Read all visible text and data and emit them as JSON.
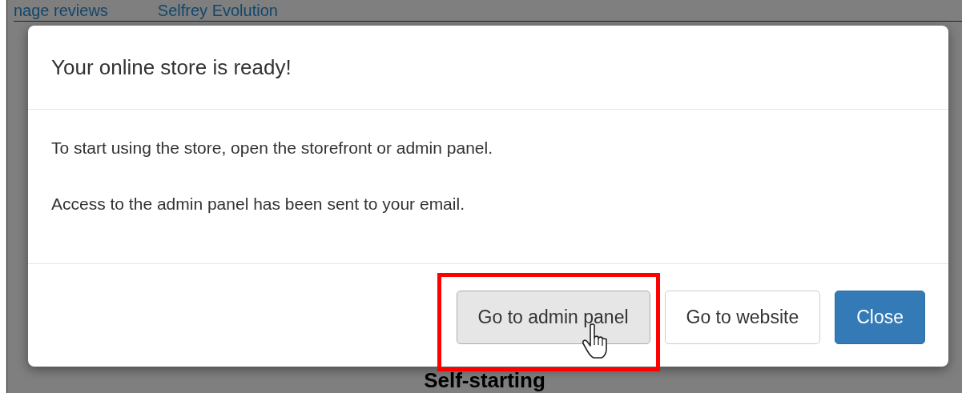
{
  "background": {
    "nav_links": [
      "nage reviews",
      "Selfrey Evolution"
    ],
    "heading": "Self-starting"
  },
  "dialog": {
    "title": "Your online store is ready!",
    "paragraphs": [
      "To start using the store, open the storefront or admin panel.",
      "Access to the admin panel has been sent to your email."
    ],
    "buttons": [
      {
        "label": "Go to admin panel",
        "kind": "default",
        "hovered": true,
        "highlighted": true
      },
      {
        "label": "Go to website",
        "kind": "default",
        "hovered": false,
        "highlighted": false
      },
      {
        "label": "Close",
        "kind": "primary",
        "hovered": false,
        "highlighted": false
      }
    ]
  }
}
